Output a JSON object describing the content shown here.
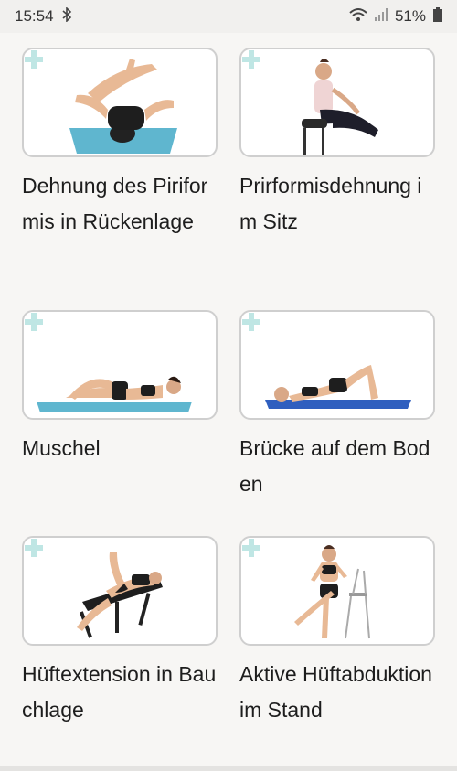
{
  "status": {
    "time": "15:54",
    "battery": "51%"
  },
  "exercises": [
    {
      "title": "Dehnung des Piriformis in Rückenlage",
      "icon": "lying-stretch-figure"
    },
    {
      "title": "Prirformisdehnung im Sitz",
      "icon": "seated-stretch-figure"
    },
    {
      "title": "Muschel",
      "icon": "side-lying-clam-figure"
    },
    {
      "title": "Brücke auf dem Boden",
      "icon": "bridge-figure"
    },
    {
      "title": "Hüftextension in Bauchlage",
      "icon": "prone-hip-extension-figure"
    },
    {
      "title": "Aktive Hüftabduktion im Stand",
      "icon": "standing-abduction-figure"
    }
  ],
  "colors": {
    "mat_teal": "#5fb6cf",
    "mat_blue": "#2f5fbf",
    "plus": "#bfe6e4"
  }
}
